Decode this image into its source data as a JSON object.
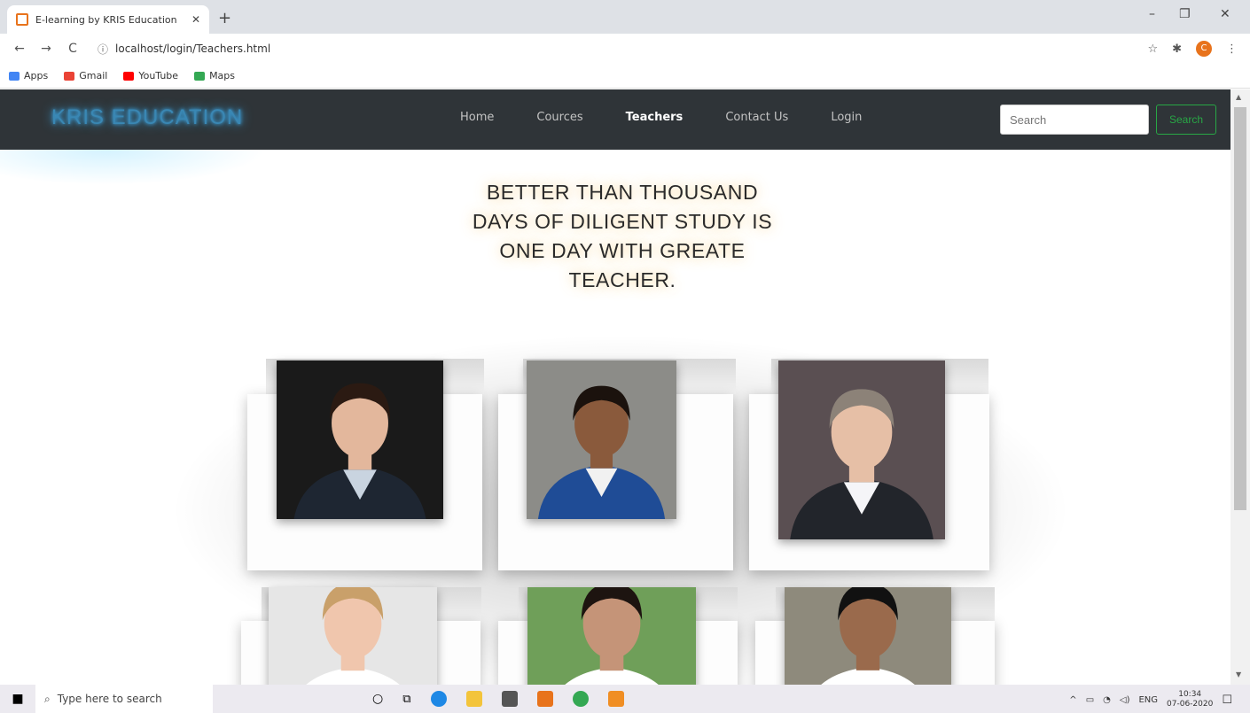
{
  "browser": {
    "tab_title": "E-learning by KRIS Education",
    "tab_close": "✕",
    "new_tab": "+",
    "url": "localhost/login/Teachers.html",
    "back": "←",
    "forward": "→",
    "reload": "C",
    "info_icon": "ⓘ",
    "star": "☆",
    "extensions": "✱",
    "profile_initial": "C",
    "menu": "⋮",
    "minimize": "–",
    "restore": "❐",
    "close": "✕"
  },
  "bookmarks": [
    {
      "label": "Apps",
      "color": "#4285f4"
    },
    {
      "label": "Gmail",
      "color": "#ea4335"
    },
    {
      "label": "YouTube",
      "color": "#ff0000"
    },
    {
      "label": "Maps",
      "color": "#34a853"
    }
  ],
  "site": {
    "brand": "KRIS EDUCATION",
    "menu": [
      "Home",
      "Cources",
      "Teachers",
      "Contact Us",
      "Login"
    ],
    "active_menu": "Teachers",
    "search_placeholder": "Search",
    "search_button": "Search",
    "quote_lines": [
      "BETTER THAN THOUSAND",
      "DAYS OF DILIGENT STUDY IS",
      "ONE DAY WITH GREATE",
      "TEACHER."
    ]
  },
  "teachers": [
    {
      "name": "teacher-1",
      "bg": "#1a1a1a",
      "skin": "#e3b79c",
      "hair": "#2b1a12",
      "shirt": "#c9d4e0",
      "suit": "#1e2632"
    },
    {
      "name": "teacher-2",
      "bg": "#8c8c88",
      "skin": "#8a5a3c",
      "hair": "#1b120d",
      "shirt": "#f1f1f1",
      "suit": "#1f4c96"
    },
    {
      "name": "teacher-3",
      "bg": "#5a4f52",
      "skin": "#e6bfa6",
      "hair": "#8c8278",
      "shirt": "#f5f5f8",
      "suit": "#22252b"
    },
    {
      "name": "teacher-4",
      "bg": "#e6e6e6",
      "skin": "#f0c6ad",
      "hair": "#c9a06a",
      "shirt": "#ffffff",
      "suit": "#ffffff"
    },
    {
      "name": "teacher-5",
      "bg": "#6f9f59",
      "skin": "#c59478",
      "hair": "#1d1410",
      "shirt": "#ffffff",
      "suit": "#ffffff"
    },
    {
      "name": "teacher-6",
      "bg": "#8e8a7c",
      "skin": "#9a6a4c",
      "hair": "#111111",
      "shirt": "#ffffff",
      "suit": "#ffffff"
    }
  ],
  "taskbar": {
    "search_placeholder": "Type here to search",
    "language": "ENG",
    "time": "10:34",
    "date": "07-06-2020"
  }
}
